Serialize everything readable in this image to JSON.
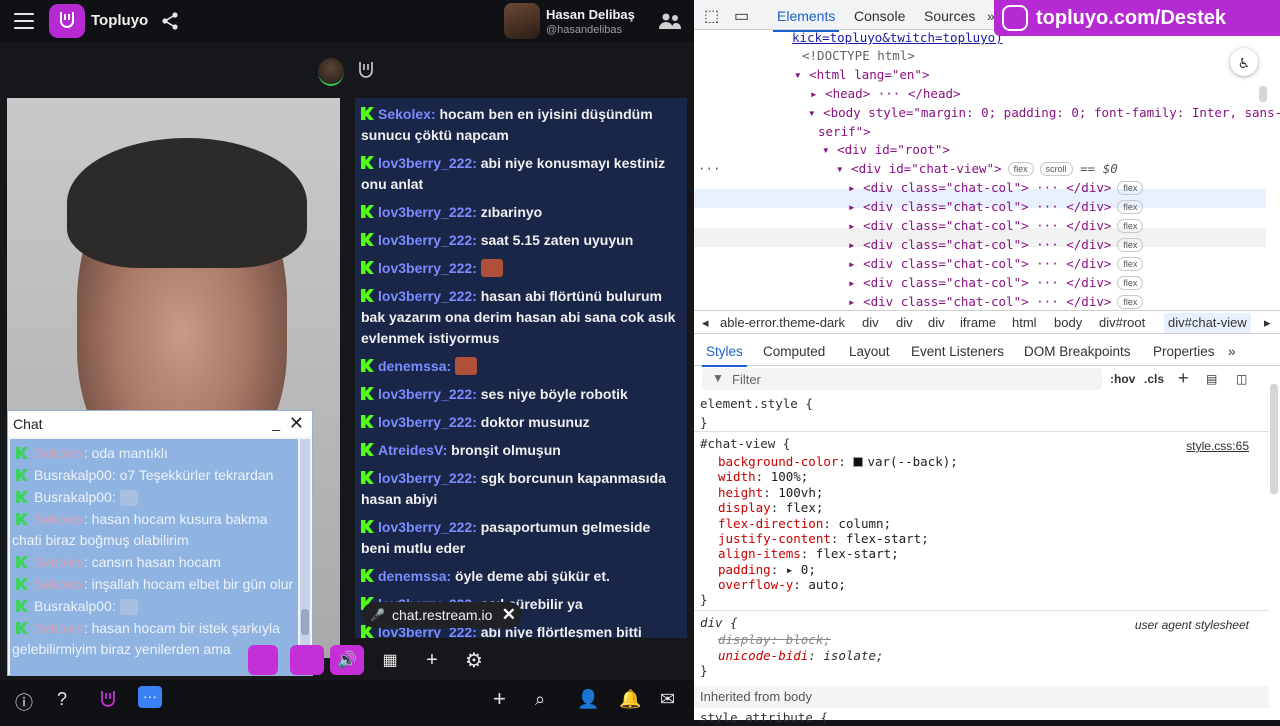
{
  "app": {
    "brand": "Topluyo",
    "user_name": "Hasan Delibaş",
    "user_handle": "@hasandelibas"
  },
  "chat": {
    "messages": [
      {
        "user": "Sekolex",
        "text": "hocam ben en iyisini düşündüm sunucu çöktü napcam"
      },
      {
        "user": "lov3berry_222",
        "text": "abi niye konusmayı kestiniz onu anlat"
      },
      {
        "user": "lov3berry_222",
        "text": "zıbarinyo"
      },
      {
        "user": "lov3berry_222",
        "text": "saat 5.15 zaten uyuyun"
      },
      {
        "user": "lov3berry_222",
        "text": "",
        "emoji": true
      },
      {
        "user": "lov3berry_222",
        "text": "hasan abi flörtünü bulurum bak yazarım ona derim hasan abi sana cok asık evlenmek istiyormus"
      },
      {
        "user": "denemssa",
        "text": "",
        "emoji": true
      },
      {
        "user": "lov3berry_222",
        "text": "ses niye böyle robotik"
      },
      {
        "user": "lov3berry_222",
        "text": "doktor musunuz"
      },
      {
        "user": "AtreidesV",
        "text": "bronşit olmuşun"
      },
      {
        "user": "lov3berry_222",
        "text": "sgk borcunun kapanmasıda hasan abiyi"
      },
      {
        "user": "lov3berry_222",
        "text": "pasaportumun gelmeside beni mutlu eder"
      },
      {
        "user": "denemssa",
        "text": "öyle deme abi şükür et."
      },
      {
        "user": "lov3berry_222",
        "text": "asıl sürebilir ya"
      },
      {
        "user": "lov3berry_222",
        "text": "abi niye flörtleşmen bitti"
      }
    ],
    "restream_chip": "chat.restream.io"
  },
  "overlay": {
    "title": "Chat",
    "minimize": "_",
    "close": "✕",
    "messages": [
      {
        "user": "Sekolex",
        "text": "oda mantıklı"
      },
      {
        "user": "Busrakalp00",
        "text": "o7 Teşekkürler tekrardan"
      },
      {
        "user": "Busrakalp00",
        "text": "",
        "emoji": true
      },
      {
        "user": "Sekolex",
        "text": "hasan hocam kusura bakma chati biraz boğmuş olabilirim"
      },
      {
        "user": "Sekolex",
        "text": "cansın hasan hocam"
      },
      {
        "user": "Sekolex",
        "text": "inşallah hocam elbet bir gün olur"
      },
      {
        "user": "Busrakalp00",
        "text": "",
        "emoji": true
      },
      {
        "user": "Sekolex",
        "text": "hasan hocam bir istek şarkıyla gelebilirmiyim biraz yenilerden ama"
      }
    ]
  },
  "devtools": {
    "tabs": [
      "Elements",
      "Console",
      "Sources"
    ],
    "active_tab": "Elements",
    "banner": "topluyo.com/Destek",
    "dom": {
      "l0": "kick=topluyo&twitch=topluyo)",
      "l1": "<!DOCTYPE html>",
      "l2": "<html lang=\"en\">",
      "l3": "<head> ··· </head>",
      "l4a": "<body style=\"margin: 0; padding: 0; font-family: Inter, sans-",
      "l4b": "serif\">",
      "l5": "<div id=\"root\">",
      "l6": "<div id=\"chat-view\">",
      "l6_badges": [
        "flex",
        "scroll"
      ],
      "l6_eq": "== $0",
      "child": "<div class=\"chat-col\"> ··· </div>",
      "child_badge": "flex"
    },
    "crumbs": [
      "able-error.theme-dark",
      "div",
      "div",
      "div",
      "iframe",
      "html",
      "body",
      "div#root",
      "div#chat-view"
    ],
    "style_tabs": [
      "Styles",
      "Computed",
      "Layout",
      "Event Listeners",
      "DOM Breakpoints",
      "Properties"
    ],
    "filter_placeholder": "Filter",
    "filter_tools": [
      ":hov",
      ".cls"
    ],
    "css": {
      "element_style": "element.style {",
      "close": "}",
      "rule_selector": "#chat-view {",
      "rule_source": "style.css:65",
      "props": [
        {
          "name": "background-color",
          "value": "var(--back);"
        },
        {
          "name": "width",
          "value": "100%;"
        },
        {
          "name": "height",
          "value": "100vh;"
        },
        {
          "name": "display",
          "value": "flex;"
        },
        {
          "name": "flex-direction",
          "value": "column;"
        },
        {
          "name": "justify-content",
          "value": "flex-start;"
        },
        {
          "name": "align-items",
          "value": "flex-start;"
        },
        {
          "name": "padding",
          "value": "▸ 0;"
        },
        {
          "name": "overflow-y",
          "value": "auto;"
        }
      ],
      "ua_selector": "div {",
      "ua_source": "user agent stylesheet",
      "ua_props": [
        {
          "name": "display",
          "value": "block;"
        },
        {
          "name": "unicode-bidi",
          "value": "isolate;"
        }
      ],
      "inherited": "Inherited from body",
      "next_rule": "style attribute {"
    }
  }
}
